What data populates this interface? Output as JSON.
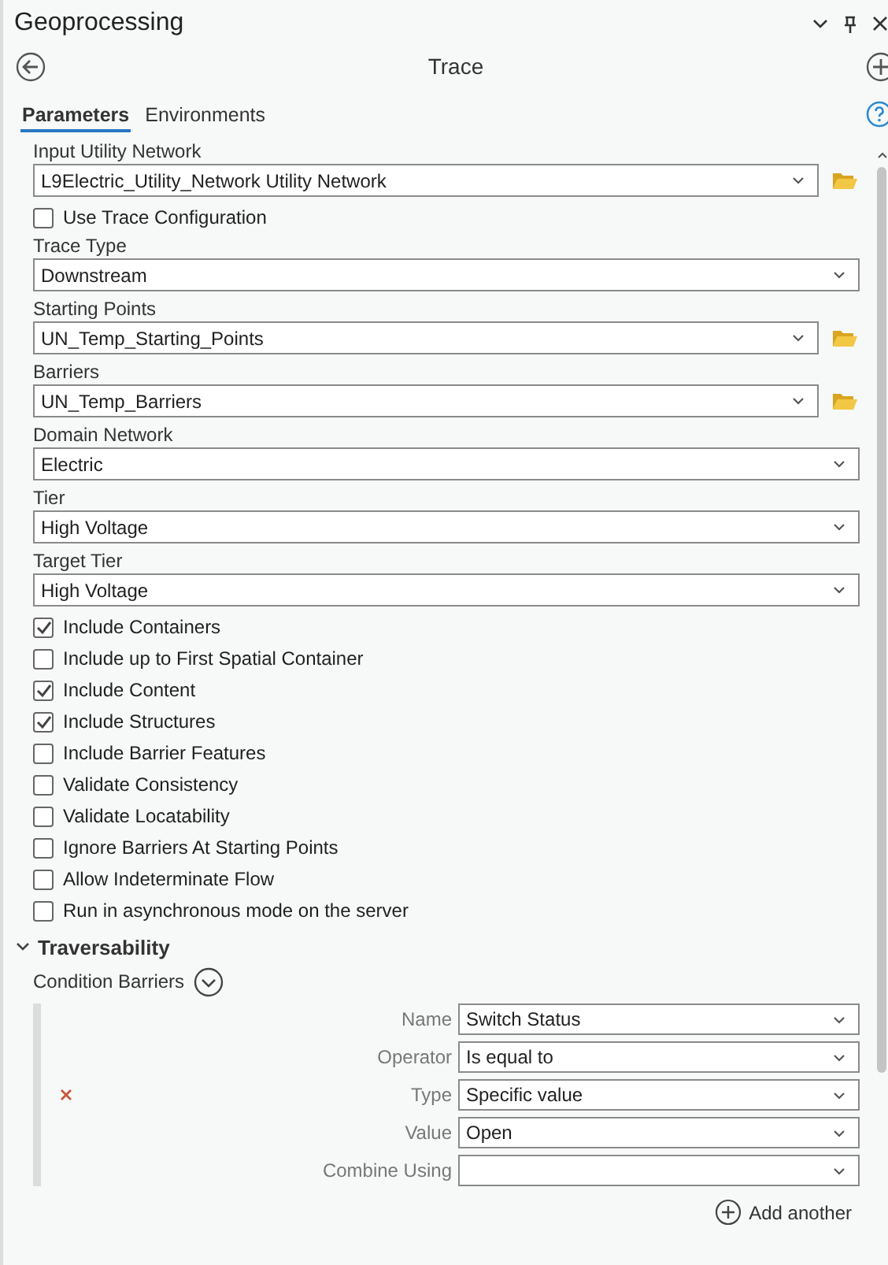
{
  "window": {
    "title": "Geoprocessing"
  },
  "tool": {
    "title": "Trace"
  },
  "tabs": [
    {
      "label": "Parameters",
      "selected": true
    },
    {
      "label": "Environments",
      "selected": false
    }
  ],
  "parameters": [
    {
      "kind": "combo",
      "label": "Input Utility Network",
      "value": "L9Electric_Utility_Network Utility Network",
      "browse": true
    },
    {
      "kind": "checkbox",
      "label": "Use Trace Configuration",
      "checked": false
    },
    {
      "kind": "combo",
      "label": "Trace Type",
      "value": "Downstream",
      "browse": false
    },
    {
      "kind": "combo",
      "label": "Starting Points",
      "value": "UN_Temp_Starting_Points",
      "browse": true
    },
    {
      "kind": "combo",
      "label": "Barriers",
      "value": "UN_Temp_Barriers",
      "browse": true
    },
    {
      "kind": "combo",
      "label": "Domain Network",
      "value": "Electric",
      "browse": false
    },
    {
      "kind": "combo",
      "label": "Tier",
      "value": "High Voltage",
      "browse": false
    },
    {
      "kind": "combo",
      "label": "Target Tier",
      "value": "High Voltage",
      "browse": false
    },
    {
      "kind": "checkbox",
      "label": "Include Containers",
      "checked": true
    },
    {
      "kind": "checkbox",
      "label": "Include up to First Spatial Container",
      "checked": false
    },
    {
      "kind": "checkbox",
      "label": "Include Content",
      "checked": true
    },
    {
      "kind": "checkbox",
      "label": "Include Structures",
      "checked": true
    },
    {
      "kind": "checkbox",
      "label": "Include Barrier Features",
      "checked": false
    },
    {
      "kind": "checkbox",
      "label": "Validate Consistency",
      "checked": false
    },
    {
      "kind": "checkbox",
      "label": "Validate Locatability",
      "checked": false
    },
    {
      "kind": "checkbox",
      "label": "Ignore Barriers At Starting Points",
      "checked": false
    },
    {
      "kind": "checkbox",
      "label": "Allow Indeterminate Flow",
      "checked": false
    },
    {
      "kind": "checkbox",
      "label": "Run in asynchronous mode on the server",
      "checked": false
    }
  ],
  "traversability": {
    "title": "Traversability",
    "expanded": true,
    "condition_barriers": {
      "label": "Condition Barriers",
      "fields": [
        {
          "label": "Name",
          "value": "Switch Status"
        },
        {
          "label": "Operator",
          "value": "Is equal to"
        },
        {
          "label": "Type",
          "value": "Specific value"
        },
        {
          "label": "Value",
          "value": "Open"
        },
        {
          "label": "Combine Using"
        }
      ],
      "add_label": "Add another"
    }
  }
}
